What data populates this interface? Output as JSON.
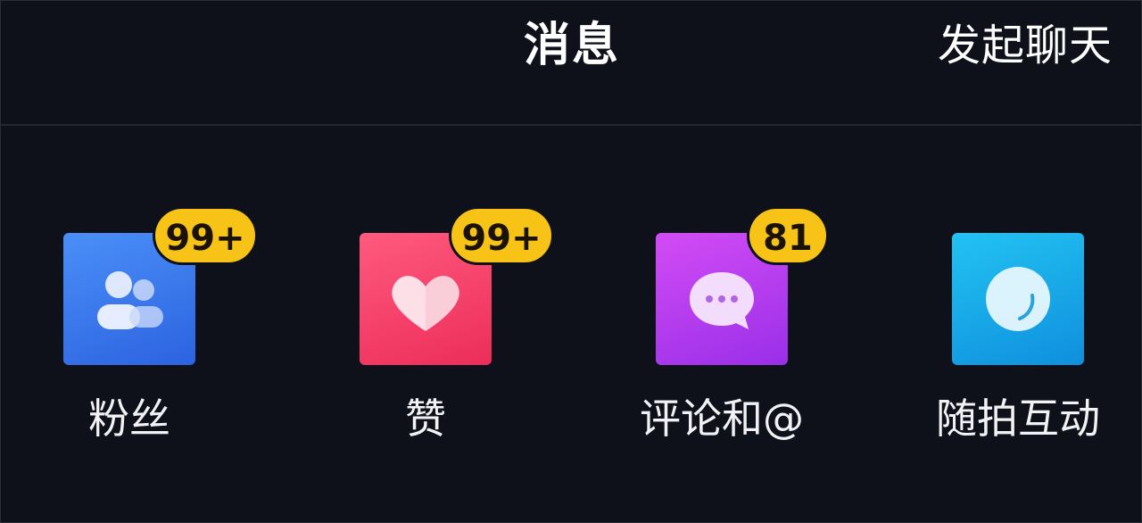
{
  "header": {
    "title": "消息",
    "start_chat_label": "发起聊天"
  },
  "tiles": [
    {
      "label": "粉丝",
      "badge": "99+",
      "icon": "fans-icon",
      "color": "#3a7cf0"
    },
    {
      "label": "赞",
      "badge": "99+",
      "icon": "heart-icon",
      "color": "#f2426a"
    },
    {
      "label": "评论和@",
      "badge": "81",
      "icon": "comment-icon",
      "color": "#b440f0"
    },
    {
      "label": "随拍互动",
      "badge": "",
      "icon": "camera-moment-icon",
      "color": "#18a8e8"
    }
  ]
}
